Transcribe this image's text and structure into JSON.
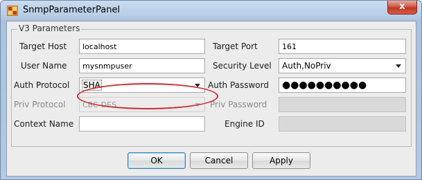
{
  "window": {
    "title": "SnmpParameterPanel",
    "close_symbol": "x",
    "icon": "java-app-icon"
  },
  "group": {
    "title": "V3 Parameters"
  },
  "fields": {
    "target_host": {
      "label": "Target Host",
      "value": "localhost"
    },
    "target_port": {
      "label": "Target Port",
      "value": "161"
    },
    "user_name": {
      "label": "User Name",
      "value": "mysnmpuser"
    },
    "security_level": {
      "label": "Security Level",
      "value": "Auth,NoPriv"
    },
    "auth_protocol": {
      "label": "Auth Protocol",
      "value": "SHA"
    },
    "auth_password": {
      "label": "Auth Password",
      "value": "●●●●●●●●●●"
    },
    "priv_protocol": {
      "label": "Priv Protocol",
      "value": "CBC-DES"
    },
    "priv_password": {
      "label": "Priv Password",
      "value": ""
    },
    "context_name": {
      "label": "Context Name",
      "value": ""
    },
    "engine_id": {
      "label": "Engine ID",
      "value": ""
    }
  },
  "buttons": {
    "ok": "OK",
    "cancel": "Cancel",
    "apply": "Apply"
  },
  "colors": {
    "annotation": "#d6262c",
    "title_bar": "#b7cde6",
    "panel": "#ececec"
  }
}
